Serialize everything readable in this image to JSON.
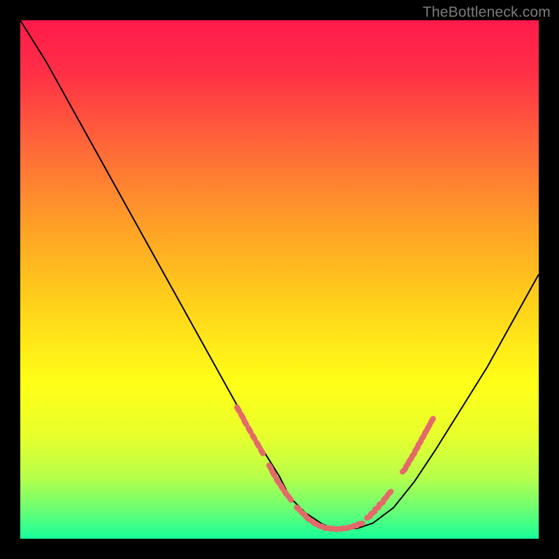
{
  "watermark": "TheBottleneck.com",
  "colors": {
    "gradient_stops": [
      {
        "offset": 0.0,
        "color": "#ff1a4b"
      },
      {
        "offset": 0.1,
        "color": "#ff2f46"
      },
      {
        "offset": 0.25,
        "color": "#ff6a38"
      },
      {
        "offset": 0.4,
        "color": "#ffa126"
      },
      {
        "offset": 0.55,
        "color": "#ffd21a"
      },
      {
        "offset": 0.7,
        "color": "#ffff18"
      },
      {
        "offset": 0.8,
        "color": "#e8ff2c"
      },
      {
        "offset": 0.88,
        "color": "#b8ff4a"
      },
      {
        "offset": 0.94,
        "color": "#6fff70"
      },
      {
        "offset": 1.0,
        "color": "#18ff9a"
      }
    ],
    "curve": "#000000",
    "data_marker": "#e46a6a",
    "background": "#000000"
  },
  "chart_data": {
    "type": "line",
    "title": "",
    "xlabel": "",
    "ylabel": "",
    "xlim": [
      0,
      100
    ],
    "ylim": [
      0,
      100
    ],
    "series": [
      {
        "name": "bottleneck-curve",
        "x": [
          0,
          5,
          10,
          15,
          20,
          25,
          30,
          35,
          40,
          45,
          50,
          52,
          55,
          58,
          60,
          62,
          65,
          68,
          72,
          76,
          80,
          85,
          90,
          95,
          100
        ],
        "y": [
          100,
          92,
          83,
          74,
          65,
          56,
          47,
          38,
          29,
          20,
          12,
          8,
          5,
          3,
          2,
          2,
          2,
          3,
          6,
          11,
          17,
          25,
          33,
          42,
          51
        ]
      }
    ],
    "data_clusters": [
      {
        "name": "left-band-top",
        "points": [
          {
            "x": 42.0,
            "y": 25.0
          },
          {
            "x": 42.8,
            "y": 23.6
          },
          {
            "x": 43.4,
            "y": 22.4
          },
          {
            "x": 44.2,
            "y": 21.0
          },
          {
            "x": 45.0,
            "y": 19.6
          },
          {
            "x": 45.8,
            "y": 18.2
          },
          {
            "x": 46.6,
            "y": 16.8
          }
        ]
      },
      {
        "name": "left-band-mid",
        "points": [
          {
            "x": 48.2,
            "y": 13.8
          },
          {
            "x": 48.8,
            "y": 12.6
          },
          {
            "x": 49.6,
            "y": 11.2
          },
          {
            "x": 50.4,
            "y": 10.0
          },
          {
            "x": 51.2,
            "y": 8.8
          },
          {
            "x": 52.0,
            "y": 7.8
          }
        ]
      },
      {
        "name": "valley",
        "points": [
          {
            "x": 53.6,
            "y": 5.8
          },
          {
            "x": 54.6,
            "y": 4.8
          },
          {
            "x": 55.5,
            "y": 3.9
          },
          {
            "x": 56.5,
            "y": 3.2
          },
          {
            "x": 57.5,
            "y": 2.6
          },
          {
            "x": 58.5,
            "y": 2.2
          },
          {
            "x": 59.6,
            "y": 2.0
          },
          {
            "x": 60.6,
            "y": 1.9
          },
          {
            "x": 61.6,
            "y": 1.9
          },
          {
            "x": 62.6,
            "y": 2.0
          },
          {
            "x": 63.6,
            "y": 2.2
          },
          {
            "x": 64.6,
            "y": 2.5
          },
          {
            "x": 65.6,
            "y": 2.9
          }
        ]
      },
      {
        "name": "right-band-low",
        "points": [
          {
            "x": 67.2,
            "y": 4.2
          },
          {
            "x": 68.0,
            "y": 5.0
          },
          {
            "x": 68.8,
            "y": 5.9
          },
          {
            "x": 69.6,
            "y": 6.8
          },
          {
            "x": 70.4,
            "y": 7.8
          },
          {
            "x": 71.2,
            "y": 8.8
          }
        ]
      },
      {
        "name": "right-band-top",
        "points": [
          {
            "x": 74.0,
            "y": 13.2
          },
          {
            "x": 74.6,
            "y": 14.2
          },
          {
            "x": 75.2,
            "y": 15.2
          },
          {
            "x": 75.8,
            "y": 16.2
          },
          {
            "x": 76.4,
            "y": 17.3
          },
          {
            "x": 77.0,
            "y": 18.4
          },
          {
            "x": 77.6,
            "y": 19.5
          },
          {
            "x": 78.2,
            "y": 20.6
          },
          {
            "x": 78.8,
            "y": 21.7
          },
          {
            "x": 79.4,
            "y": 22.8
          }
        ]
      }
    ]
  }
}
